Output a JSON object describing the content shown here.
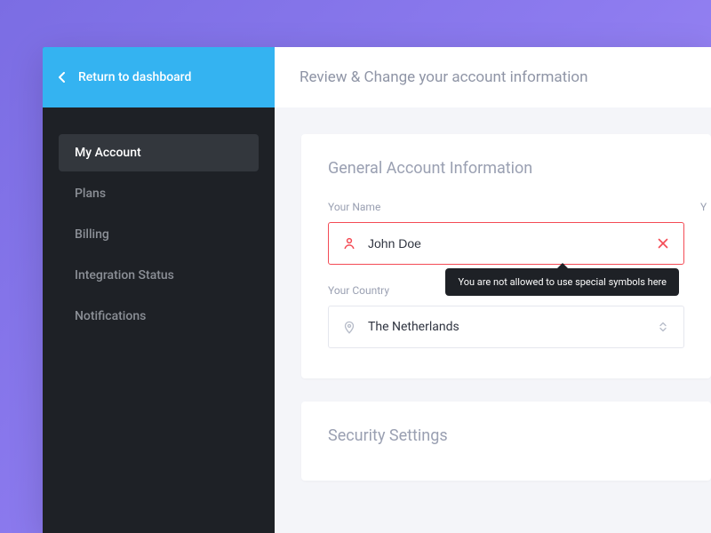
{
  "sidebar": {
    "return_label": "Return to dashboard",
    "items": [
      {
        "label": "My Account",
        "active": true
      },
      {
        "label": "Plans",
        "active": false
      },
      {
        "label": "Billing",
        "active": false
      },
      {
        "label": "Integration Status",
        "active": false
      },
      {
        "label": "Notifications",
        "active": false
      }
    ]
  },
  "header": {
    "title": "Review & Change your account information"
  },
  "general": {
    "card_title": "General Account Information",
    "name_label": "Your Name",
    "name_value": "John Doe",
    "name_error_tooltip": "You are not allowed to use special symbols here",
    "country_label": "Your Country",
    "country_value": "The Netherlands",
    "truncated_right_label": "Y"
  },
  "security": {
    "card_title": "Security Settings"
  },
  "colors": {
    "accent": "#34b3f1",
    "error": "#f44b55",
    "sidebar_bg": "#1e2126"
  }
}
